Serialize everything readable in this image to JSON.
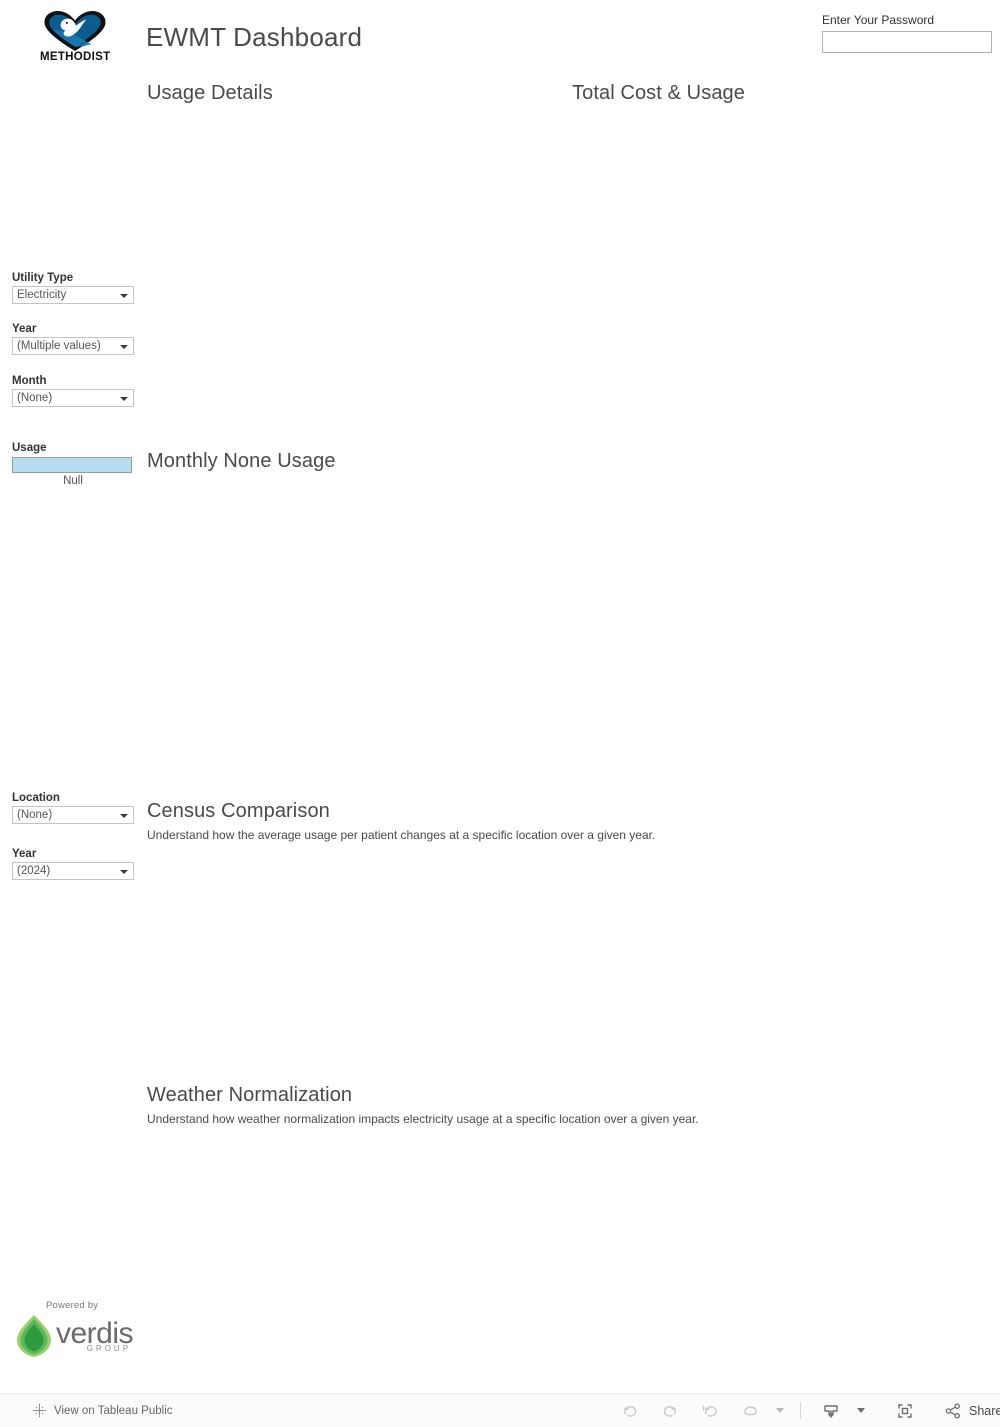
{
  "header": {
    "logo_name": "methodist-logo",
    "logo_wordmark": "METHODIST",
    "title": "EWMT Dashboard"
  },
  "password": {
    "label": "Enter Your Password",
    "value": "",
    "placeholder": ""
  },
  "sections": {
    "usage_details": {
      "title": "Usage Details"
    },
    "total_cost_usage": {
      "title": "Total Cost & Usage"
    },
    "monthly_usage": {
      "title": "Monthly None Usage"
    },
    "census_comparison": {
      "title": "Census Comparison",
      "subtitle": "Understand how the average usage per patient changes at a specific location over a given year."
    },
    "weather_normalization": {
      "title": "Weather Normalization",
      "subtitle": "Understand how weather normalization impacts electricity usage at a specific location over a given year."
    }
  },
  "filters": {
    "utility_type": {
      "label": "Utility Type",
      "value": "Electricity"
    },
    "year_top": {
      "label": "Year",
      "value": "(Multiple values)"
    },
    "month": {
      "label": "Month",
      "value": "(None)"
    },
    "location": {
      "label": "Location",
      "value": "(None)"
    },
    "year_census": {
      "label": "Year",
      "value": "(2024)"
    }
  },
  "legend": {
    "label": "Usage",
    "value": "Null",
    "color": "#b6dcef",
    "border_color": "#9a9a9a"
  },
  "verdis": {
    "powered_by": "Powered by",
    "name": "verdis",
    "group": "GROUP",
    "color_dark": "#2e9b3f",
    "color_mid": "#5cb85c",
    "color_light": "#9ccf6a"
  },
  "toolbar": {
    "tableau_link": "View on Tableau Public",
    "undo": "Undo",
    "redo": "Redo",
    "revert": "Revert",
    "refresh": "Refresh",
    "pause_caret": "Pause Automatic Updates",
    "download": "Download",
    "fullscreen": "Full Screen",
    "share": "Share"
  }
}
